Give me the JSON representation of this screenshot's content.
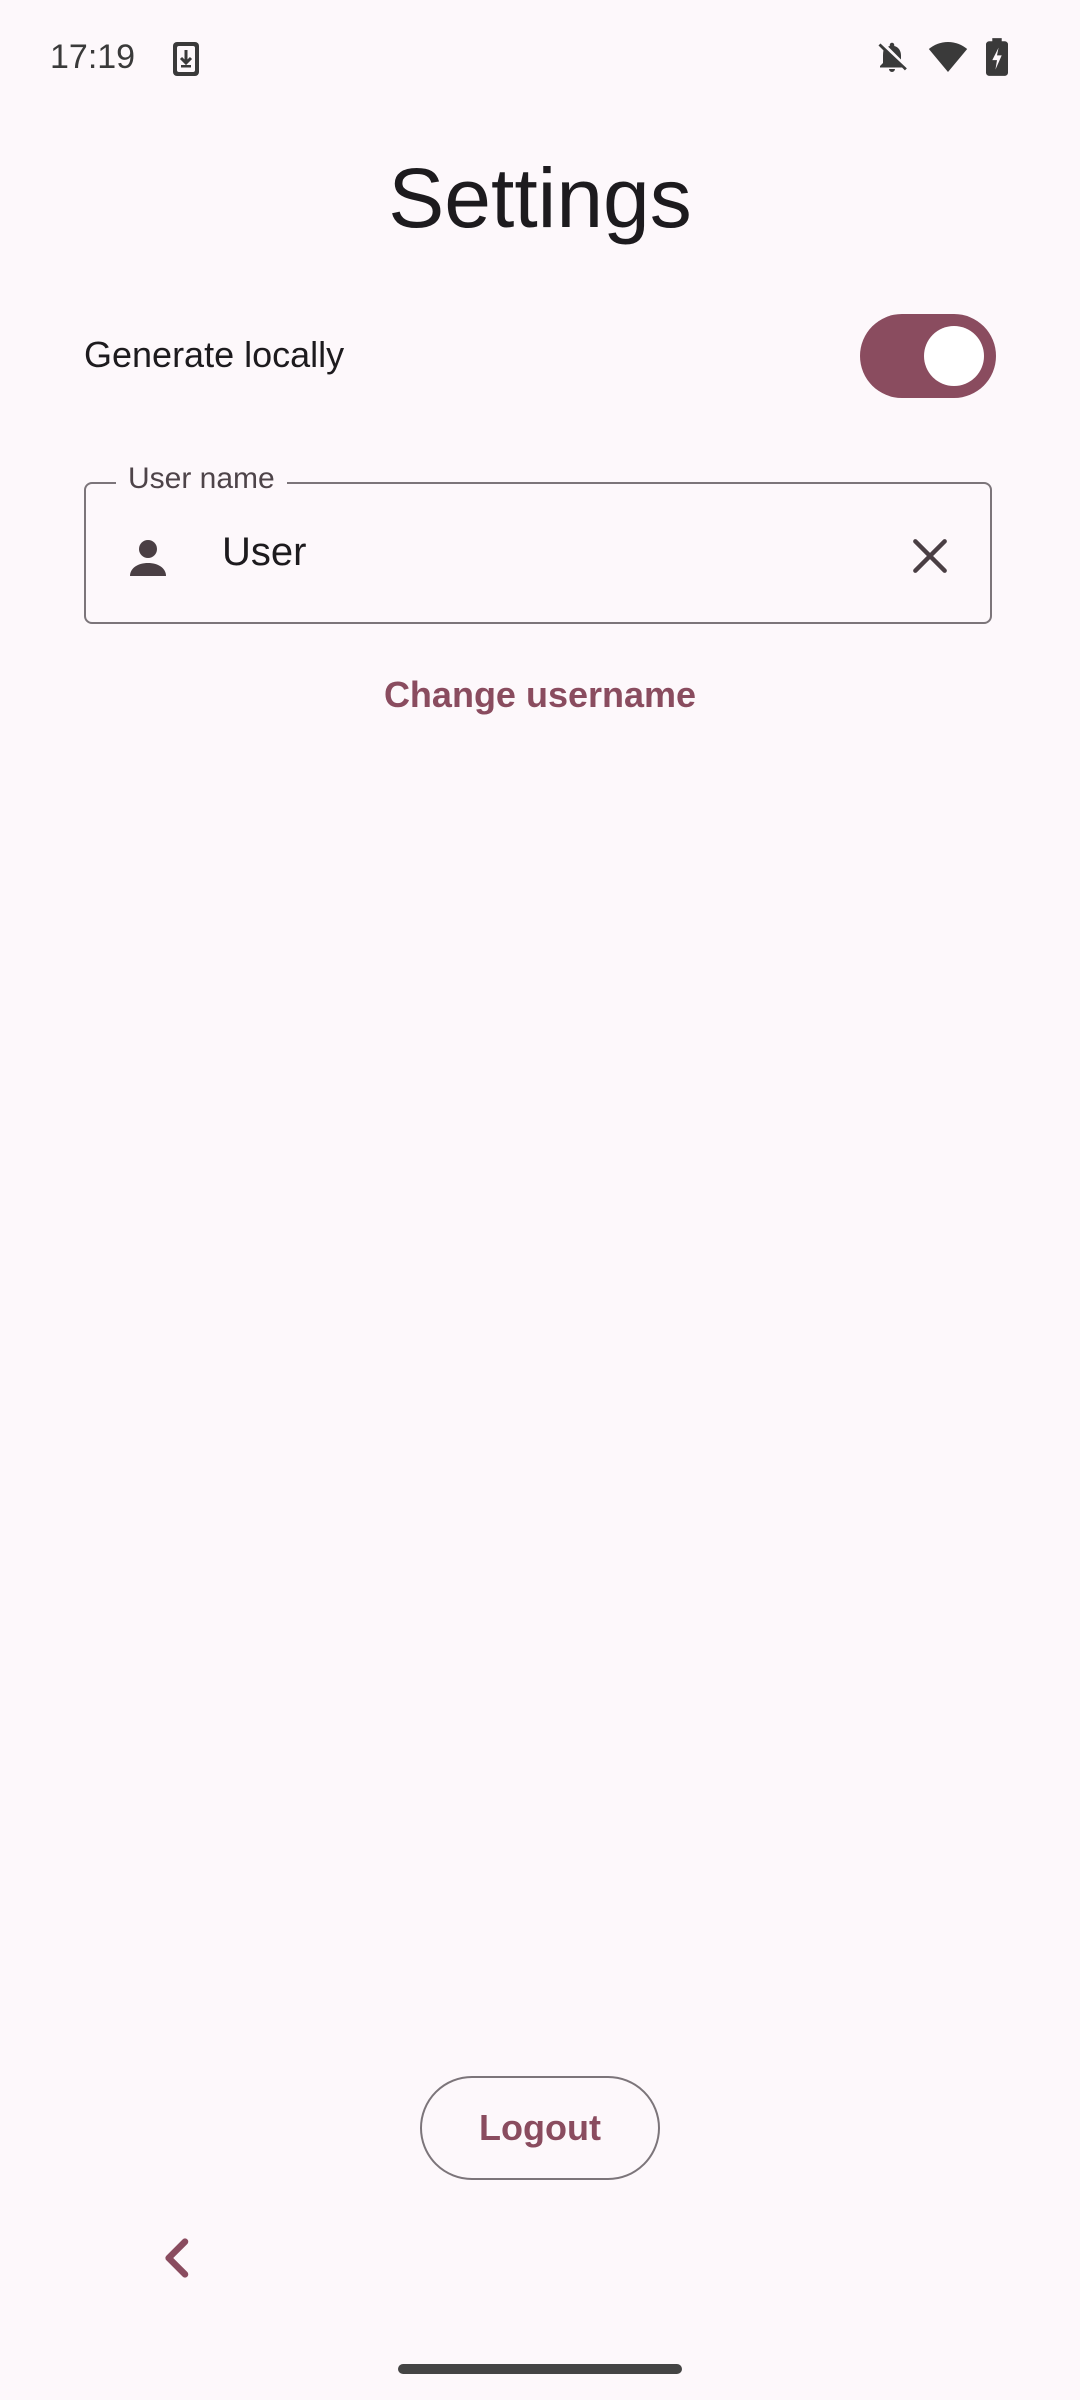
{
  "status_bar": {
    "time": "17:19",
    "icons": [
      "download-icon",
      "bell-off-icon",
      "wifi-icon",
      "battery-charging-icon"
    ]
  },
  "page": {
    "title": "Settings"
  },
  "settings": {
    "generate_locally": {
      "label": "Generate locally",
      "enabled": true
    }
  },
  "username_field": {
    "label": "User name",
    "value": "User",
    "leading_icon": "person-icon",
    "trailing_icon": "close-icon"
  },
  "actions": {
    "change_username": "Change username",
    "logout": "Logout"
  },
  "colors": {
    "accent": "#8a4c5f",
    "background": "#fdf8fb",
    "outline": "#7c757a"
  }
}
